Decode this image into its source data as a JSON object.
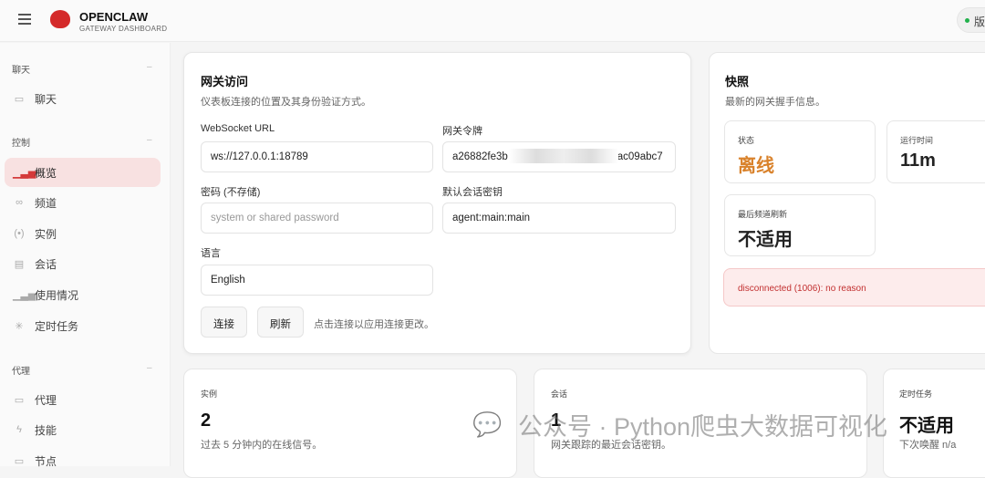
{
  "header": {
    "brand": "OPENCLAW",
    "subtitle": "GATEWAY DASHBOARD",
    "version_label": "版"
  },
  "sidebar": {
    "sections": [
      {
        "label": "聊天",
        "items": [
          {
            "label": "聊天",
            "icon": "chat-icon"
          }
        ]
      },
      {
        "label": "控制",
        "items": [
          {
            "label": "概览",
            "icon": "bar-chart-icon",
            "active": true
          },
          {
            "label": "频道",
            "icon": "link-icon"
          },
          {
            "label": "实例",
            "icon": "radio-icon"
          },
          {
            "label": "会话",
            "icon": "document-icon"
          },
          {
            "label": "使用情况",
            "icon": "bar-chart-icon"
          },
          {
            "label": "定时任务",
            "icon": "loader-icon"
          }
        ]
      },
      {
        "label": "代理",
        "items": [
          {
            "label": "代理",
            "icon": "folder-icon"
          },
          {
            "label": "技能",
            "icon": "bolt-icon"
          },
          {
            "label": "节点",
            "icon": "monitor-icon"
          }
        ]
      }
    ]
  },
  "gateway": {
    "title": "网关访问",
    "desc": "仪表板连接的位置及其身份验证方式。",
    "ws_label": "WebSocket URL",
    "ws_value": "ws://127.0.0.1:18789",
    "token_label": "网关令牌",
    "token_value_start": "a26882fe3b",
    "token_value_end": "ac09abc7",
    "password_label": "密码 (不存储)",
    "password_placeholder": "system or shared password",
    "session_label": "默认会话密钥",
    "session_value": "agent:main:main",
    "lang_label": "语言",
    "lang_value": "English",
    "connect": "连接",
    "refresh": "刷新",
    "hint": "点击连接以应用连接更改。"
  },
  "snapshot": {
    "title": "快照",
    "desc": "最新的网关握手信息。",
    "status_label": "状态",
    "status_value": "离线",
    "status_color": "#d9822b",
    "uptime_label": "运行时间",
    "uptime_value": "11m",
    "refresh_label": "最后频道刷新",
    "refresh_value": "不适用",
    "error": "disconnected (1006): no reason"
  },
  "stats": [
    {
      "label": "实例",
      "value": "2",
      "desc": "过去 5 分钟内的在线信号。"
    },
    {
      "label": "会话",
      "value": "1",
      "desc": "网关跟踪的最近会话密钥。"
    },
    {
      "label": "定时任务",
      "value": "不适用",
      "desc": "下次唤醒 n/a"
    }
  ],
  "watermark": "公众号 · Python爬虫大数据可视化"
}
